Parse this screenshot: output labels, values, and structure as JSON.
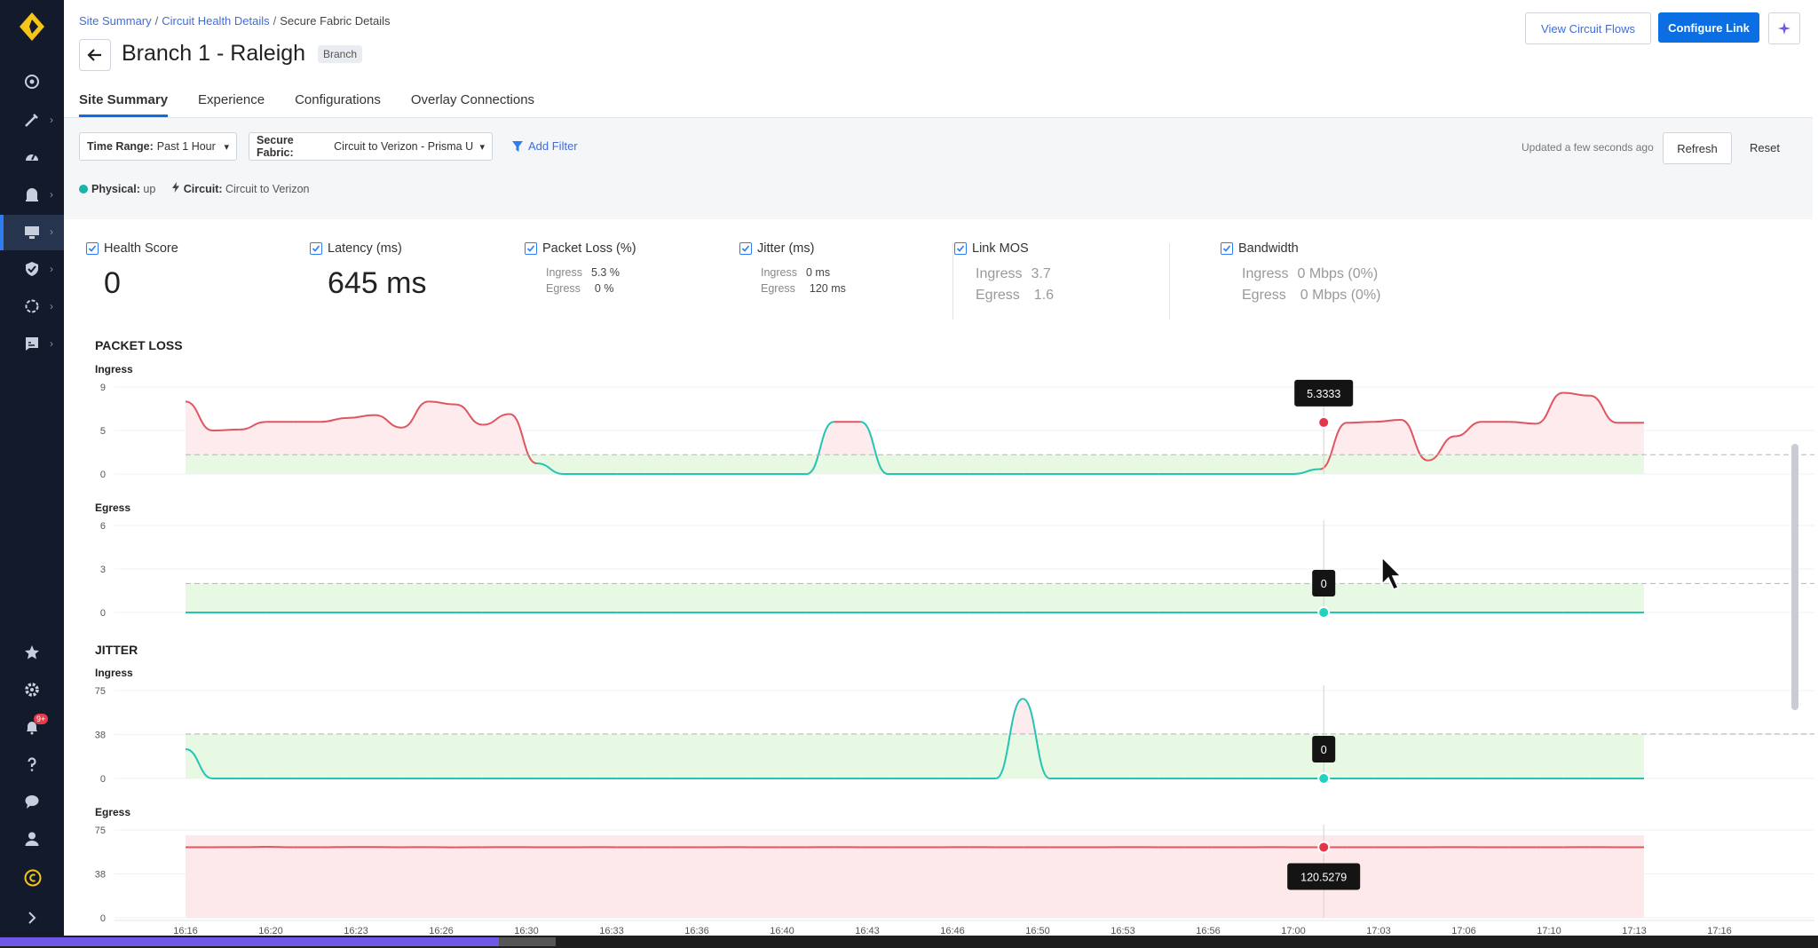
{
  "sidebar": {
    "notif_count": "9+"
  },
  "breadcrumb": {
    "item1": "Site Summary",
    "item2": "Circuit Health Details",
    "current": "Secure Fabric Details",
    "separator": "/"
  },
  "header": {
    "title": "Branch 1 - Raleigh",
    "badge": "Branch",
    "view_flows": "View Circuit Flows",
    "configure": "Configure Link"
  },
  "tabs": [
    "Site Summary",
    "Experience",
    "Configurations",
    "Overlay Connections"
  ],
  "filters": {
    "time_label": "Time Range:",
    "time_value": "Past 1 Hour",
    "fabric_label": "Secure Fabric:",
    "fabric_value": "Circuit to Verizon - Prisma US",
    "add_filter": "Add Filter",
    "updated": "Updated a few seconds ago",
    "refresh": "Refresh",
    "reset": "Reset"
  },
  "status": {
    "physical_label": "Physical:",
    "physical_value": "up",
    "circuit_label": "Circuit:",
    "circuit_value": "Circuit to Verizon"
  },
  "metrics": {
    "health": {
      "label": "Health Score",
      "value": "0"
    },
    "latency": {
      "label": "Latency (ms)",
      "value": "645 ms"
    },
    "packet_loss": {
      "label": "Packet Loss (%)",
      "ingress_label": "Ingress",
      "ingress": "5.3 %",
      "egress_label": "Egress",
      "egress": "0 %"
    },
    "jitter": {
      "label": "Jitter (ms)",
      "ingress_label": "Ingress",
      "ingress": "0 ms",
      "egress_label": "Egress",
      "egress": "120 ms"
    },
    "mos": {
      "label": "Link MOS",
      "ingress_label": "Ingress",
      "ingress": "3.7",
      "egress_label": "Egress",
      "egress": "1.6"
    },
    "bandwidth": {
      "label": "Bandwidth",
      "ingress_label": "Ingress",
      "ingress": "0 Mbps (0%)",
      "egress_label": "Egress",
      "egress": "0 Mbps (0%)"
    }
  },
  "chart_data": {
    "type": "area",
    "x": [
      "16:16",
      "16:20",
      "16:23",
      "16:26",
      "16:30",
      "16:33",
      "16:36",
      "16:40",
      "16:43",
      "16:46",
      "16:50",
      "16:53",
      "16:56",
      "17:00",
      "17:03",
      "17:06",
      "17:10",
      "17:13",
      "17:16"
    ],
    "colors": {
      "red_line": "#e05560",
      "red_fill": "#fde8ea",
      "teal_line": "#22c4b4",
      "green_fill": "#e7f8e3",
      "threshold": "#b5b5b5"
    },
    "sections": [
      {
        "title": "PACKET LOSS",
        "panels": [
          {
            "label": "Ingress",
            "y_ticks": [
              "9",
              "5",
              "0"
            ],
            "ylim": [
              0,
              9
            ],
            "threshold": 2,
            "values": [
              7.5,
              4.5,
              4.6,
              5.4,
              5.4,
              5.4,
              5.8,
              6.1,
              4.8,
              7.5,
              7.2,
              5.1,
              6.2,
              1.1,
              0,
              0,
              0,
              0,
              0,
              0,
              0,
              0,
              0,
              0,
              5.4,
              5.4,
              0,
              0,
              0,
              0,
              0,
              0,
              0,
              0,
              0,
              0,
              0,
              0,
              0,
              0,
              0,
              0,
              0.5,
              5.3,
              5.4,
              5.6,
              1.4,
              3.9,
              5.4,
              5.4,
              5.2,
              8.4,
              8.1,
              5.3,
              5.3
            ],
            "tooltip": {
              "label": "5.3333",
              "value": 5.3333,
              "x_fraction": 0.7804
            }
          },
          {
            "label": "Egress",
            "y_ticks": [
              "6",
              "3",
              "0"
            ],
            "ylim": [
              0,
              6
            ],
            "threshold": 2,
            "values": [
              0,
              0,
              0,
              0,
              0,
              0,
              0,
              0,
              0,
              0,
              0,
              0,
              0,
              0,
              0,
              0,
              0,
              0,
              0,
              0,
              0,
              0,
              0,
              0,
              0,
              0,
              0,
              0,
              0,
              0,
              0,
              0,
              0,
              0,
              0,
              0,
              0,
              0,
              0,
              0,
              0,
              0,
              0,
              0,
              0,
              0,
              0,
              0,
              0,
              0,
              0,
              0,
              0,
              0,
              0
            ],
            "tooltip": {
              "label": "0",
              "value": 0,
              "x_fraction": 0.7804
            }
          }
        ]
      },
      {
        "title": "JITTER",
        "panels": [
          {
            "label": "Ingress",
            "y_ticks": [
              "75",
              "38",
              "0"
            ],
            "ylim": [
              0,
              75
            ],
            "threshold": 38,
            "values": [
              25,
              0,
              0,
              0,
              0,
              0,
              0,
              0,
              0,
              0,
              0,
              0,
              0,
              0,
              0,
              0,
              0,
              0,
              0,
              0,
              0,
              0,
              0,
              0,
              0,
              0,
              0,
              0,
              0,
              0,
              0,
              68,
              0,
              0,
              0,
              0,
              0,
              0,
              0,
              0,
              0,
              0,
              0,
              0,
              0,
              0,
              0,
              0,
              0,
              0,
              0,
              0,
              0,
              0,
              0
            ],
            "tooltip": {
              "label": "0",
              "value": 0,
              "x_fraction": 0.7804
            }
          },
          {
            "label": "Egress",
            "y_ticks": [
              "75",
              "38",
              "0"
            ],
            "ylim": [
              0,
              150
            ],
            "threshold": null,
            "values": [
              120.5,
              120.5,
              120.6,
              121.2,
              120.4,
              120.5,
              120.8,
              120.9,
              120.5,
              120.6,
              120.3,
              120.5,
              120.7,
              120.5,
              120.4,
              120.6,
              120.5,
              120.5,
              120.5,
              120.4,
              120.6,
              120.5,
              120.5,
              120.5,
              120.6,
              120.5,
              120.4,
              120.5,
              120.5,
              120.6,
              120.5,
              120.5,
              120.4,
              120.5,
              120.5,
              120.6,
              120.5,
              120.5,
              120.5,
              120.4,
              120.6,
              120.5,
              120.5,
              120.5,
              120.5,
              120.5,
              120.5,
              120.6,
              120.5,
              120.4,
              120.5,
              120.5,
              120.6,
              120.5,
              120.5
            ],
            "tooltip": {
              "label": "120.5279",
              "value": 120.5279,
              "x_fraction": 0.7804
            }
          }
        ]
      }
    ]
  }
}
